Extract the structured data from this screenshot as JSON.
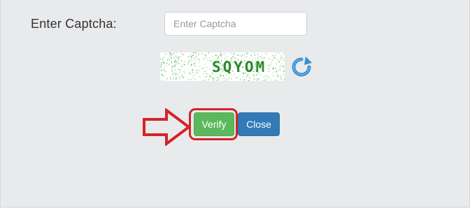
{
  "form": {
    "label": "Enter Captcha:",
    "input_placeholder": "Enter Captcha",
    "input_value": "",
    "captcha_text": "SQYOM"
  },
  "actions": {
    "verify_label": "Verify",
    "close_label": "Close"
  },
  "icons": {
    "refresh": "refresh-icon",
    "annotation_arrow": "arrow-right-icon"
  },
  "colors": {
    "background": "#e9eaec",
    "verify": "#5cb85c",
    "close": "#337ab7",
    "annotation": "#d42328",
    "captcha_text": "#2a8a2a",
    "refresh": "#3a8fd0"
  }
}
